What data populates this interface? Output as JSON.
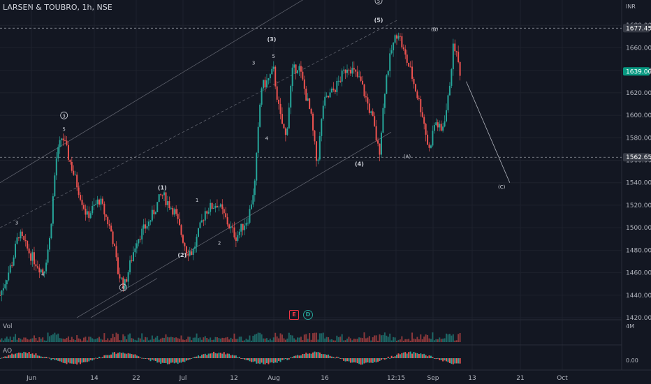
{
  "header": {
    "symbol": "LARSEN & TOUBRO",
    "interval": "1h",
    "exchange": "NSE",
    "title": "LARSEN & TOUBRO, 1h, NSE"
  },
  "chart_data": {
    "type": "candlestick",
    "currency": "INR",
    "ylim": [
      1420,
      1700
    ],
    "y_ticks": [
      1420,
      1440,
      1460,
      1480,
      1500,
      1520,
      1540,
      1560,
      1580,
      1600,
      1620,
      1640,
      1660,
      1680
    ],
    "x_ticks": [
      "Jun",
      "14",
      "22",
      "Jul",
      "12",
      "Aug",
      "16",
      "12:15",
      "Sep",
      "13",
      "21",
      "Oct"
    ],
    "price_labels": [
      {
        "value": 1677.45,
        "text": "1677.45",
        "color": "#363a45"
      },
      {
        "value": 1639.0,
        "text": "1639.00",
        "color": "#089981"
      },
      {
        "value": 1562.65,
        "text": "1562.65",
        "color": "#363a45"
      }
    ],
    "price_path": [
      [
        0,
        1440
      ],
      [
        0.02,
        1470
      ],
      [
        0.03,
        1495
      ],
      [
        0.05,
        1475
      ],
      [
        0.07,
        1460
      ],
      [
        0.08,
        1490
      ],
      [
        0.09,
        1560
      ],
      [
        0.1,
        1582
      ],
      [
        0.12,
        1545
      ],
      [
        0.14,
        1510
      ],
      [
        0.16,
        1525
      ],
      [
        0.18,
        1495
      ],
      [
        0.19,
        1460
      ],
      [
        0.2,
        1448
      ],
      [
        0.22,
        1490
      ],
      [
        0.24,
        1505
      ],
      [
        0.26,
        1530
      ],
      [
        0.28,
        1515
      ],
      [
        0.3,
        1480
      ],
      [
        0.31,
        1478
      ],
      [
        0.33,
        1515
      ],
      [
        0.35,
        1522
      ],
      [
        0.37,
        1500
      ],
      [
        0.38,
        1492
      ],
      [
        0.4,
        1510
      ],
      [
        0.41,
        1540
      ],
      [
        0.42,
        1625
      ],
      [
        0.43,
        1630
      ],
      [
        0.44,
        1640
      ],
      [
        0.45,
        1600
      ],
      [
        0.46,
        1580
      ],
      [
        0.47,
        1638
      ],
      [
        0.48,
        1645
      ],
      [
        0.5,
        1600
      ],
      [
        0.51,
        1555
      ],
      [
        0.52,
        1610
      ],
      [
        0.54,
        1625
      ],
      [
        0.56,
        1645
      ],
      [
        0.58,
        1630
      ],
      [
        0.6,
        1595
      ],
      [
        0.61,
        1565
      ],
      [
        0.62,
        1630
      ],
      [
        0.63,
        1658
      ],
      [
        0.64,
        1676
      ],
      [
        0.65,
        1655
      ],
      [
        0.66,
        1640
      ],
      [
        0.67,
        1620
      ],
      [
        0.68,
        1600
      ],
      [
        0.69,
        1568
      ],
      [
        0.7,
        1595
      ],
      [
        0.71,
        1585
      ],
      [
        0.72,
        1610
      ],
      [
        0.73,
        1665
      ],
      [
        0.74,
        1639
      ]
    ],
    "projection": {
      "from": [
        0.75,
        1630
      ],
      "to": [
        0.82,
        1540
      ]
    },
    "wave_labels": [
      {
        "text": "3",
        "x": 0.027,
        "y": 1503
      },
      {
        "text": "4",
        "x": 0.069,
        "y": 1457
      },
      {
        "text": "5",
        "x": 0.103,
        "y": 1586
      },
      {
        "text": "3",
        "x": 0.103,
        "y": 1598,
        "circled": true
      },
      {
        "text": "4",
        "x": 0.198,
        "y": 1445,
        "circled": true
      },
      {
        "text": "(1)",
        "x": 0.261,
        "y": 1534,
        "bold": true
      },
      {
        "text": "(2)",
        "x": 0.293,
        "y": 1474,
        "bold": true
      },
      {
        "text": "1",
        "x": 0.317,
        "y": 1523
      },
      {
        "text": "2",
        "x": 0.353,
        "y": 1485
      },
      {
        "text": "3",
        "x": 0.408,
        "y": 1645
      },
      {
        "text": "(3)",
        "x": 0.437,
        "y": 1666,
        "bold": true
      },
      {
        "text": "5",
        "x": 0.44,
        "y": 1651
      },
      {
        "text": "4",
        "x": 0.429,
        "y": 1578
      },
      {
        "text": "(4)",
        "x": 0.578,
        "y": 1555,
        "bold": true
      },
      {
        "text": "(5)",
        "x": 0.609,
        "y": 1683,
        "bold": true
      },
      {
        "text": "5",
        "x": 0.609,
        "y": 1700,
        "circled": true
      },
      {
        "text": "(B)",
        "x": 0.699,
        "y": 1675
      },
      {
        "text": "(A)",
        "x": 0.655,
        "y": 1562
      },
      {
        "text": "(C)",
        "x": 0.807,
        "y": 1535
      }
    ],
    "volume": {
      "label": "Vol",
      "scale_label": "4M"
    },
    "oscillator": {
      "label": "AO",
      "scale_label": "0.00"
    },
    "events": [
      {
        "text": "E",
        "type": "earnings"
      },
      {
        "text": "D",
        "type": "dividend"
      }
    ],
    "colors": {
      "up": "#26a69a",
      "down": "#ef5350",
      "grid": "#1e222d",
      "background": "#131722",
      "line": "#787b86"
    }
  }
}
